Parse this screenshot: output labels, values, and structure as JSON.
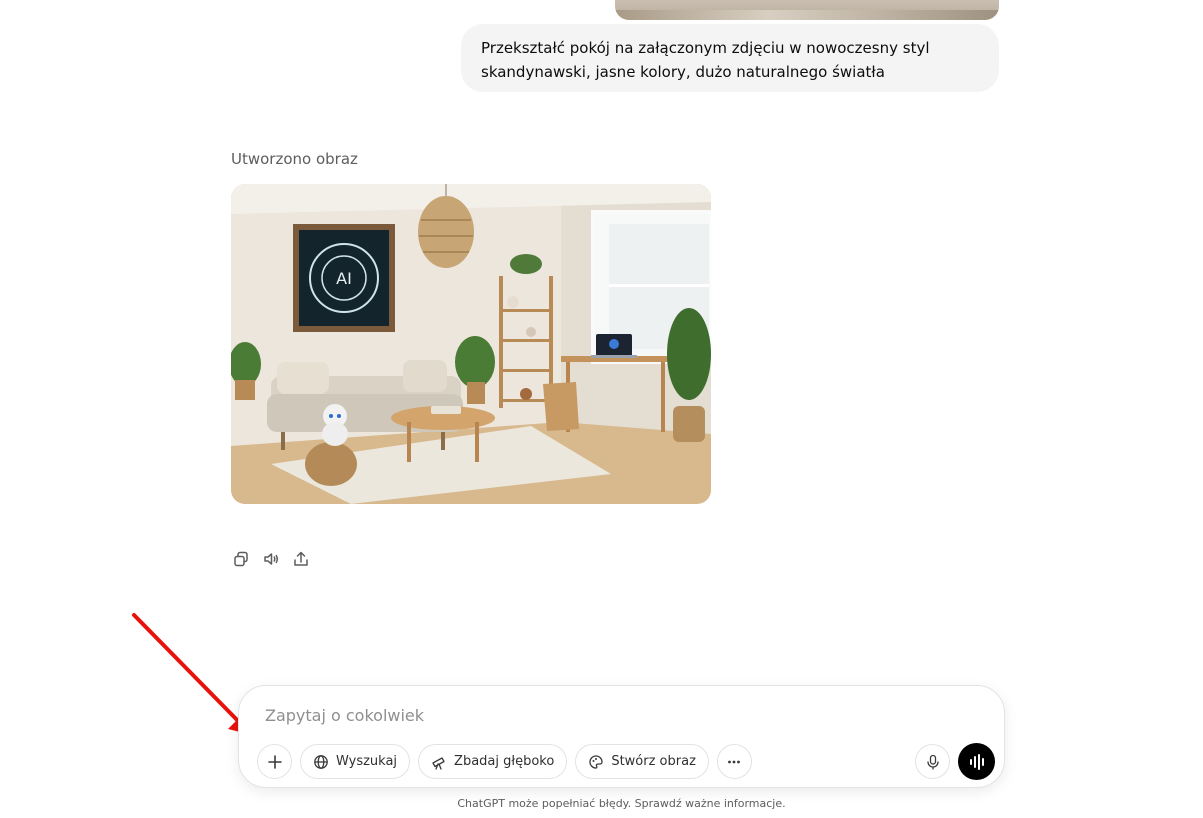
{
  "conversation": {
    "user_message": "Przekształć pokój na załączonym zdjęciu w nowoczesny styl skandynawski, jasne kolory, dużo naturalnego światła",
    "assistant_label": "Utworzono obraz",
    "generated_image": {
      "poster_text": "AI"
    },
    "actions": [
      {
        "name": "copy-icon"
      },
      {
        "name": "read-aloud-icon"
      },
      {
        "name": "share-icon"
      }
    ]
  },
  "composer": {
    "placeholder": "Zapytaj o cokolwiek",
    "value": "",
    "tools": {
      "add_icon": "plus-icon",
      "search_label": "Wyszukaj",
      "deep_research_label": "Zbadaj głęboko",
      "create_image_label": "Stwórz obraz",
      "more_icon": "ellipsis-icon"
    },
    "mic_icon": "microphone-icon",
    "voice_icon": "voice-mode-icon"
  },
  "footer": {
    "disclaimer": "ChatGPT może popełniać błędy. Sprawdź ważne informacje."
  },
  "annotation": {
    "arrow_color": "#e8120c"
  }
}
